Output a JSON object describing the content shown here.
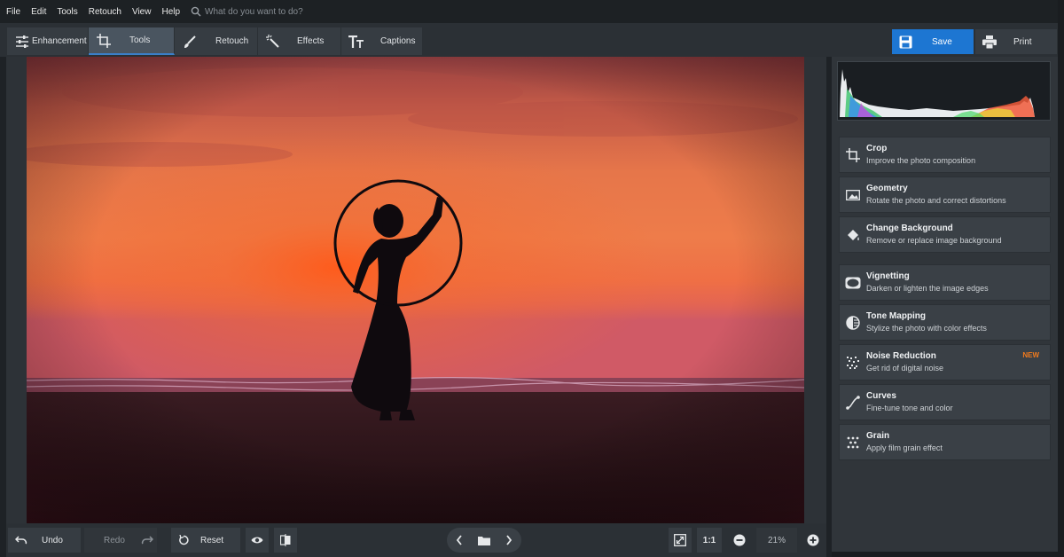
{
  "menu": {
    "items": [
      "File",
      "Edit",
      "Tools",
      "Retouch",
      "View",
      "Help"
    ],
    "search_placeholder": "What do you want to do?",
    "search_icon": "search-icon"
  },
  "tabs": [
    {
      "label": "Enhancement",
      "icon": "sliders-icon",
      "active": false
    },
    {
      "label": "Tools",
      "icon": "crop-icon",
      "active": true
    },
    {
      "label": "Retouch",
      "icon": "brush-icon",
      "active": false
    },
    {
      "label": "Effects",
      "icon": "magic-wand-icon",
      "active": false
    },
    {
      "label": "Captions",
      "icon": "text-icon",
      "active": false
    }
  ],
  "actions": {
    "save_label": "Save",
    "print_label": "Print",
    "save_color": "#1d76d2"
  },
  "tools_panel": [
    {
      "name": "Crop",
      "desc": "Improve the photo composition",
      "icon": "crop-icon"
    },
    {
      "name": "Geometry",
      "desc": "Rotate the photo and correct distortions",
      "icon": "geometry-icon"
    },
    {
      "name": "Change Background",
      "desc": "Remove or replace image background",
      "icon": "paint-bucket-icon"
    },
    {
      "name": "Vignetting",
      "desc": "Darken or lighten the image edges",
      "icon": "vignette-icon"
    },
    {
      "name": "Tone Mapping",
      "desc": "Stylize the photo with color effects",
      "icon": "tone-mapping-icon"
    },
    {
      "name": "Noise Reduction",
      "desc": "Get rid of digital noise",
      "icon": "noise-icon",
      "badge": "NEW"
    },
    {
      "name": "Curves",
      "desc": "Fine-tune tone and color",
      "icon": "curves-icon"
    },
    {
      "name": "Grain",
      "desc": "Apply film grain effect",
      "icon": "grain-icon"
    }
  ],
  "bottom": {
    "undo_label": "Undo",
    "redo_label": "Redo",
    "reset_label": "Reset",
    "ratio_label": "1:1",
    "zoom": "21%"
  },
  "badge_color": "#f07a1e"
}
